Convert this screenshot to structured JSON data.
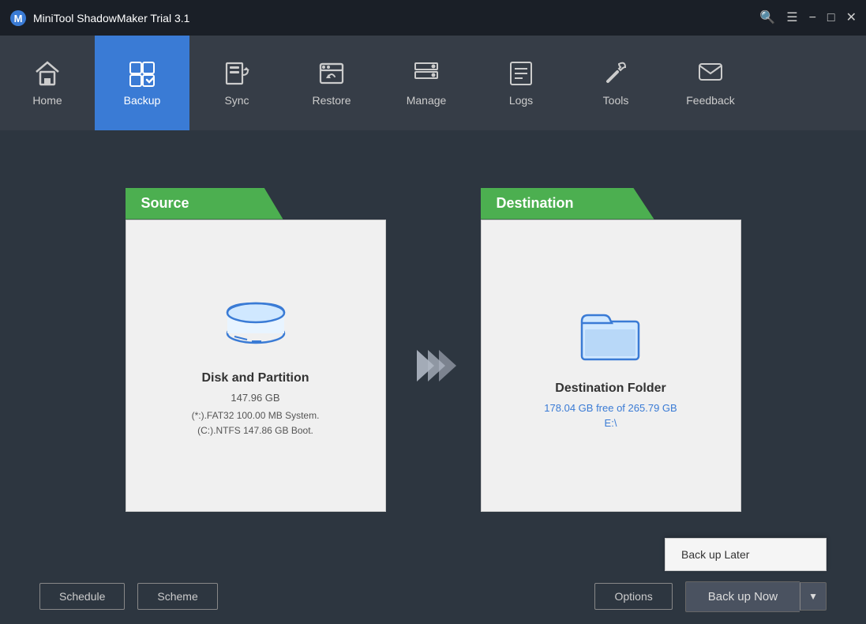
{
  "app": {
    "title": "MiniTool ShadowMaker Trial 3.1"
  },
  "nav": {
    "items": [
      {
        "id": "home",
        "label": "Home",
        "active": false
      },
      {
        "id": "backup",
        "label": "Backup",
        "active": true
      },
      {
        "id": "sync",
        "label": "Sync",
        "active": false
      },
      {
        "id": "restore",
        "label": "Restore",
        "active": false
      },
      {
        "id": "manage",
        "label": "Manage",
        "active": false
      },
      {
        "id": "logs",
        "label": "Logs",
        "active": false
      },
      {
        "id": "tools",
        "label": "Tools",
        "active": false
      },
      {
        "id": "feedback",
        "label": "Feedback",
        "active": false
      }
    ]
  },
  "source": {
    "header": "Source",
    "title": "Disk and Partition",
    "size": "147.96 GB",
    "detail_line1": "(*:).FAT32 100.00 MB System.",
    "detail_line2": "(C:).NTFS 147.86 GB Boot."
  },
  "destination": {
    "header": "Destination",
    "title": "Destination Folder",
    "size_label": "178.04 GB free of 265.79 GB",
    "drive": "E:\\"
  },
  "bottom": {
    "schedule_label": "Schedule",
    "scheme_label": "Scheme",
    "options_label": "Options",
    "backup_now_label": "Back up Now",
    "backup_later_label": "Back up Later"
  }
}
